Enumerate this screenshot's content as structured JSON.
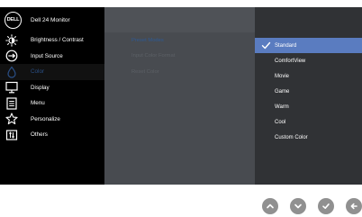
{
  "header": {
    "logo_text": "DELL",
    "monitor_model": "Dell 24 Monitor"
  },
  "sidebar": {
    "items": [
      {
        "label": "Brightness / Contrast",
        "icon": "brightness-icon"
      },
      {
        "label": "Input Source",
        "icon": "input-source-icon"
      },
      {
        "label": "Color",
        "icon": "color-icon",
        "active": true
      },
      {
        "label": "Display",
        "icon": "display-icon"
      },
      {
        "label": "Menu",
        "icon": "menu-icon"
      },
      {
        "label": "Personalize",
        "icon": "star-icon"
      },
      {
        "label": "Others",
        "icon": "others-icon"
      }
    ]
  },
  "submenu": {
    "items": [
      {
        "label": "Preset Modes",
        "active": true
      },
      {
        "label": "Input Color Format"
      },
      {
        "label": "Reset Color"
      }
    ]
  },
  "options": {
    "items": [
      {
        "label": "Standard",
        "selected": true
      },
      {
        "label": "ComfortView"
      },
      {
        "label": "Movie"
      },
      {
        "label": "Game"
      },
      {
        "label": "Warm"
      },
      {
        "label": "Cool"
      },
      {
        "label": "Custom Color"
      }
    ]
  },
  "nav_buttons": [
    {
      "icon": "chevron-up-icon"
    },
    {
      "icon": "chevron-down-icon"
    },
    {
      "icon": "check-icon"
    },
    {
      "icon": "back-arrow-icon"
    }
  ],
  "colors": {
    "sidebar_bg": "#000000",
    "middle_bg": "#484b50",
    "right_bg": "#303235",
    "selection": "#5a7cc0",
    "active_text": "#2a4f86",
    "nav_button": "#909090"
  }
}
